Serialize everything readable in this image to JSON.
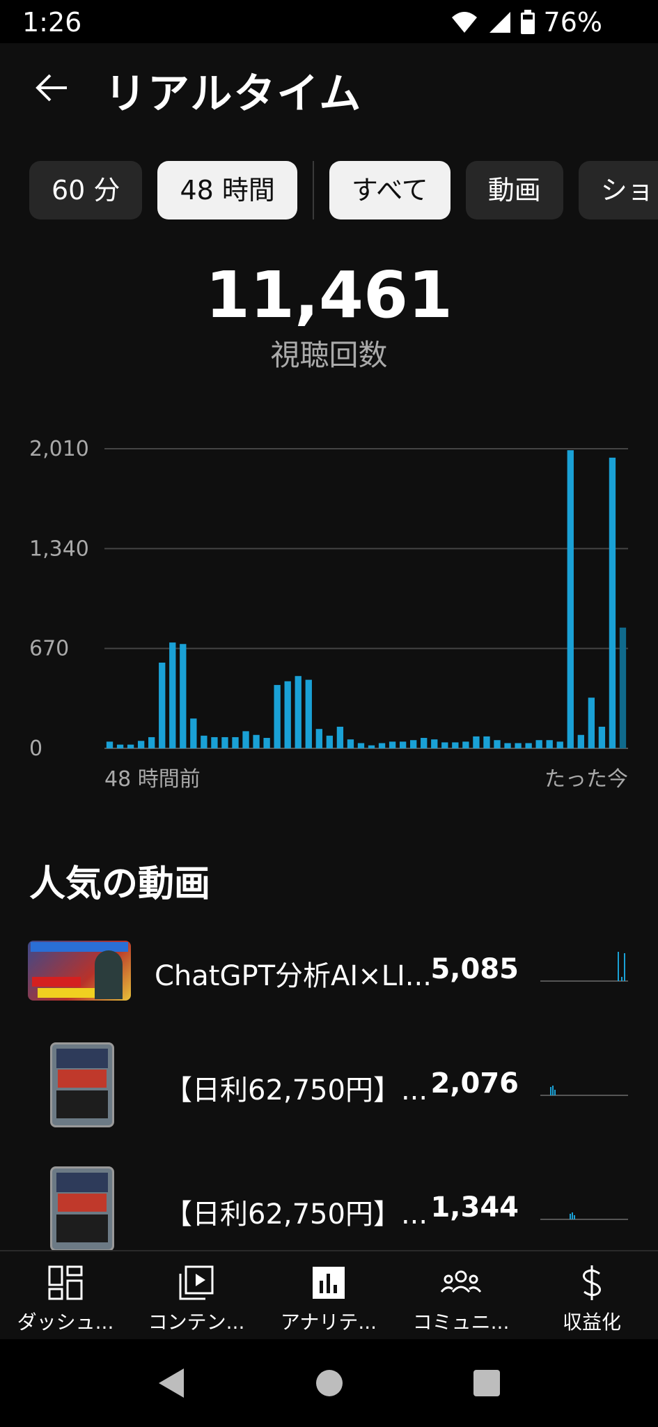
{
  "status": {
    "time": "1:26",
    "battery": "76%"
  },
  "header": {
    "title": "リアルタイム",
    "back_icon": "arrow-left-icon"
  },
  "chips": [
    {
      "label": "60 分",
      "selected": false
    },
    {
      "label": "48 時間",
      "selected": true
    },
    {
      "label": "すべて",
      "selected": true
    },
    {
      "label": "動画",
      "selected": false
    },
    {
      "label": "ショ",
      "selected": false
    }
  ],
  "summary": {
    "value": "11,461",
    "label": "視聴回数"
  },
  "chart_data": {
    "type": "bar",
    "y_ticks": [
      "2,010",
      "1,340",
      "670",
      "0"
    ],
    "ylim": [
      0,
      2010
    ],
    "x_start_label": "48 時間前",
    "x_end_label": "たった今",
    "bar_color": "#1aa1d6",
    "values": [
      45,
      25,
      25,
      50,
      75,
      575,
      710,
      700,
      200,
      85,
      75,
      75,
      75,
      115,
      90,
      70,
      425,
      450,
      485,
      460,
      130,
      85,
      145,
      60,
      35,
      20,
      35,
      45,
      45,
      55,
      70,
      60,
      40,
      40,
      45,
      80,
      80,
      55,
      35,
      35,
      35,
      55,
      55,
      45,
      2000,
      90,
      340,
      145,
      1950,
      810
    ]
  },
  "popular": {
    "title": "人気の動画",
    "videos": [
      {
        "title": "ChatGPT分析AI×LI...",
        "count": "5,085"
      },
      {
        "title": "【日利62,750円】...",
        "count": "2,076"
      },
      {
        "title": "【日利62,750円】...",
        "count": "1,344"
      }
    ]
  },
  "nav": [
    {
      "label": "ダッシュ...",
      "icon": "dashboard-icon"
    },
    {
      "label": "コンテン...",
      "icon": "content-icon"
    },
    {
      "label": "アナリテ...",
      "icon": "analytics-icon"
    },
    {
      "label": "コミュニ...",
      "icon": "community-icon"
    },
    {
      "label": "収益化",
      "icon": "dollar-icon"
    }
  ]
}
